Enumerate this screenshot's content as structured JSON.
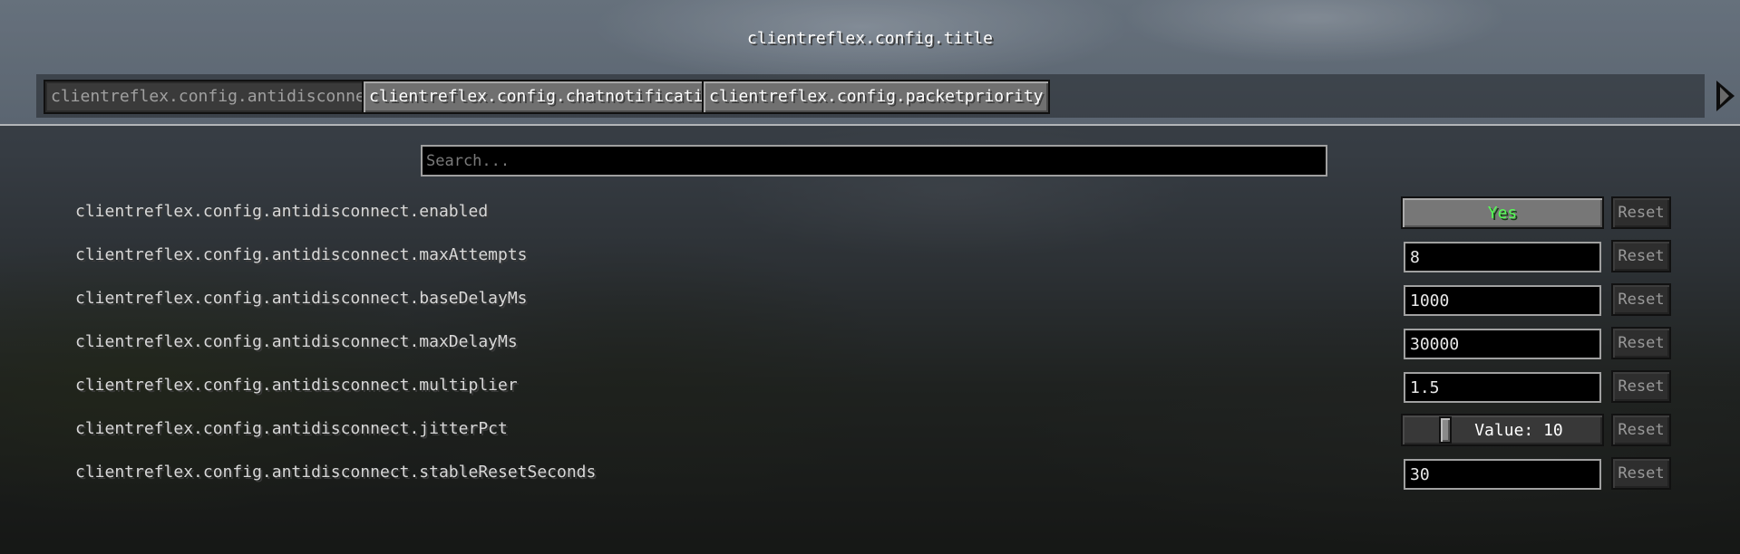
{
  "screen": {
    "title": "clientreflex.config.title"
  },
  "tabs": [
    {
      "label": "clientreflex.config.antidisconnect",
      "active": true
    },
    {
      "label": "clientreflex.config.chatnotifications",
      "active": false
    },
    {
      "label": "clientreflex.config.packetpriority",
      "active": false
    }
  ],
  "search": {
    "placeholder": "Search...",
    "value": ""
  },
  "reset_label": "Reset",
  "options": [
    {
      "label": "clientreflex.config.antidisconnect.enabled",
      "type": "toggle",
      "value": "Yes",
      "value_color": "#55ff55"
    },
    {
      "label": "clientreflex.config.antidisconnect.maxAttempts",
      "type": "text",
      "value": "8"
    },
    {
      "label": "clientreflex.config.antidisconnect.baseDelayMs",
      "type": "text",
      "value": "1000"
    },
    {
      "label": "clientreflex.config.antidisconnect.maxDelayMs",
      "type": "text",
      "value": "30000"
    },
    {
      "label": "clientreflex.config.antidisconnect.multiplier",
      "type": "text",
      "value": "1.5"
    },
    {
      "label": "clientreflex.config.antidisconnect.jitterPct",
      "type": "slider",
      "value": 10,
      "value_text": "Value: 10"
    },
    {
      "label": "clientreflex.config.antidisconnect.stableResetSeconds",
      "type": "text",
      "value": "30"
    }
  ],
  "icons": {
    "tab_scroll": "arrow-right-icon"
  }
}
